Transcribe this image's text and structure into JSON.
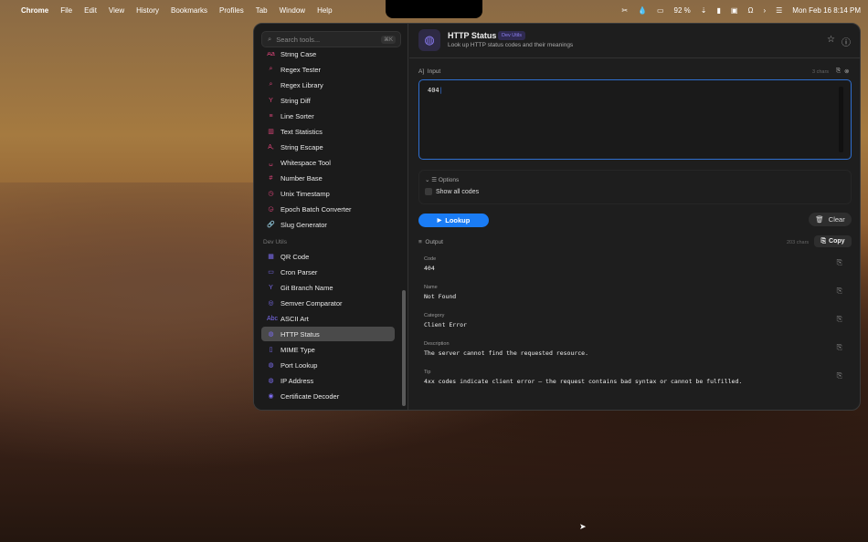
{
  "menubar": {
    "app": "Chrome",
    "items": [
      "File",
      "Edit",
      "View",
      "History",
      "Bookmarks",
      "Profiles",
      "Tab",
      "Window",
      "Help"
    ],
    "battery": "92 %",
    "datetime": "Mon Feb 16  8:14 PM"
  },
  "sidebar": {
    "search_placeholder": "Search tools...",
    "search_shortcut": "⌘K",
    "items_top": [
      {
        "label": "String Case",
        "icon": "Aa"
      },
      {
        "label": "Regex Tester",
        "icon": "⌕"
      },
      {
        "label": "Regex Library",
        "icon": "⌕"
      },
      {
        "label": "String Diff",
        "icon": "Y"
      },
      {
        "label": "Line Sorter",
        "icon": "≡"
      },
      {
        "label": "Text Statistics",
        "icon": "▥"
      },
      {
        "label": "String Escape",
        "icon": "A,"
      },
      {
        "label": "Whitespace Tool",
        "icon": "␣"
      },
      {
        "label": "Number Base",
        "icon": "#"
      },
      {
        "label": "Unix Timestamp",
        "icon": "◷"
      },
      {
        "label": "Epoch Batch Converter",
        "icon": "◶"
      },
      {
        "label": "Slug Generator",
        "icon": "🔗"
      }
    ],
    "section": "Dev Utils",
    "items_dev": [
      {
        "label": "QR Code",
        "icon": "▦"
      },
      {
        "label": "Cron Parser",
        "icon": "▭"
      },
      {
        "label": "Git Branch Name",
        "icon": "Y"
      },
      {
        "label": "Semver Comparator",
        "icon": "◎"
      },
      {
        "label": "ASCII Art",
        "icon": "Abc"
      },
      {
        "label": "HTTP Status",
        "icon": "◍"
      },
      {
        "label": "MIME Type",
        "icon": "▯"
      },
      {
        "label": "Port Lookup",
        "icon": "◍"
      },
      {
        "label": "IP Address",
        "icon": "◍"
      },
      {
        "label": "Certificate Decoder",
        "icon": "◉"
      }
    ]
  },
  "header": {
    "title": "HTTP Status",
    "badge": "Dev Utils",
    "subtitle": "Look up HTTP status codes and their meanings"
  },
  "input": {
    "label": "Input",
    "chars": "3 chars",
    "value": "404"
  },
  "options": {
    "label": "Options",
    "show_all": "Show all codes"
  },
  "buttons": {
    "lookup": "Lookup",
    "clear": "Clear",
    "copy": "Copy"
  },
  "output": {
    "label": "Output",
    "chars": "203 chars",
    "fields": [
      {
        "label": "Code",
        "value": "404"
      },
      {
        "label": "Name",
        "value": "Not Found"
      },
      {
        "label": "Category",
        "value": "Client Error"
      },
      {
        "label": "Description",
        "value": "The server cannot find the requested resource."
      },
      {
        "label": "Tip",
        "value": "4xx codes indicate client error — the request contains bad syntax or cannot be fulfilled."
      }
    ]
  }
}
